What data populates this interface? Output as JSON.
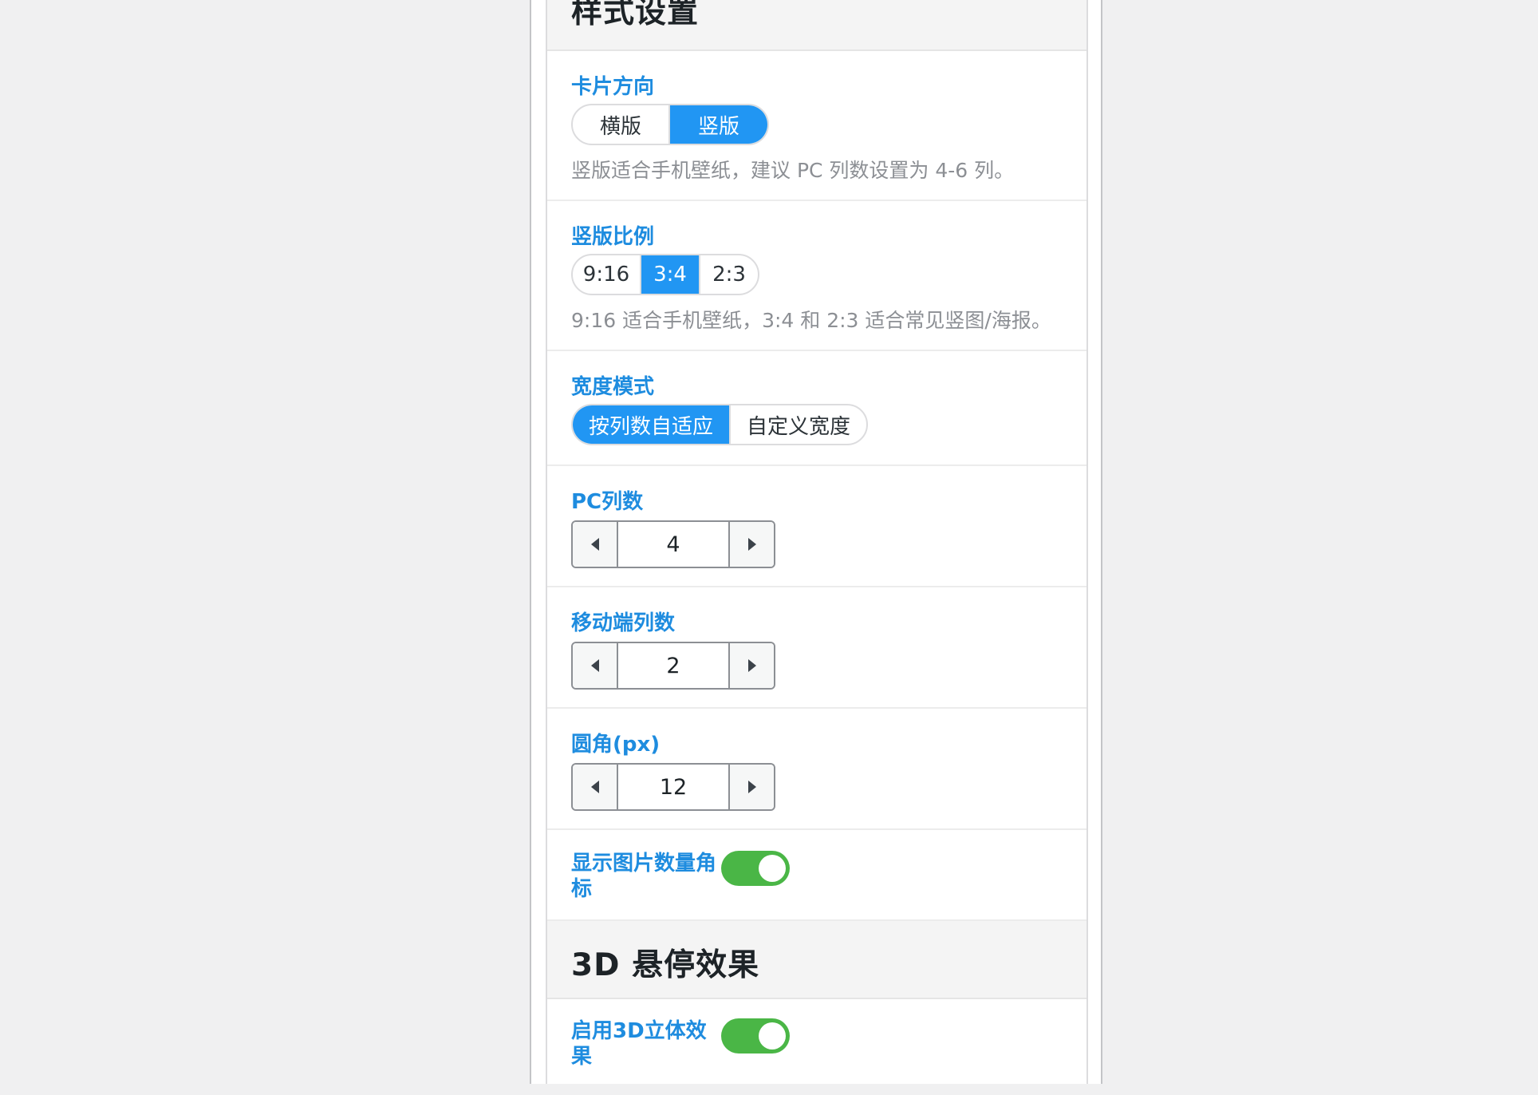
{
  "style_section": {
    "title": "样式设置"
  },
  "card_orientation": {
    "label": "卡片方向",
    "options": [
      "横版",
      "竖版"
    ],
    "selected": "竖版",
    "description": "竖版适合手机壁纸，建议 PC 列数设置为 4-6 列。"
  },
  "portrait_ratio": {
    "label": "竖版比例",
    "options": [
      "9:16",
      "3:4",
      "2:3"
    ],
    "selected": "3:4",
    "description": "9:16 适合手机壁纸，3:4 和 2:3 适合常见竖图/海报。"
  },
  "width_mode": {
    "label": "宽度模式",
    "options": [
      "按列数自适应",
      "自定义宽度"
    ],
    "selected": "按列数自适应"
  },
  "pc_columns": {
    "label": "PC列数",
    "value": "4",
    "decrement_icon": "triangle-left-icon",
    "increment_icon": "triangle-right-icon"
  },
  "mobile_columns": {
    "label": "移动端列数",
    "value": "2"
  },
  "corner_radius": {
    "label": "圆角(px)",
    "value": "12"
  },
  "show_count_badge": {
    "label": "显示图片数量角标",
    "enabled": true
  },
  "hover_section": {
    "title": "3D 悬停效果"
  },
  "enable_3d": {
    "label": "启用3D立体效果",
    "enabled": true
  },
  "colors": {
    "accent_blue": "#2196f3",
    "label_blue": "#1e8cdf",
    "toggle_green": "#4ab646",
    "muted_text": "#8c8f94"
  }
}
